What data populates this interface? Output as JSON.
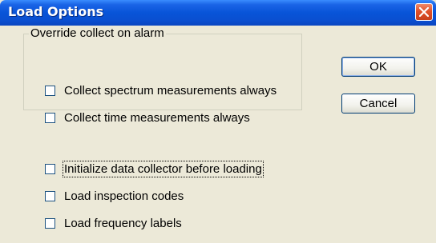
{
  "window": {
    "title": "Load Options",
    "close_icon": "close-icon"
  },
  "group": {
    "legend": "Override collect on alarm",
    "options": [
      {
        "label": "Collect spectrum measurements always",
        "checked": false
      },
      {
        "label": "Collect time measurements always",
        "checked": false
      }
    ]
  },
  "options": [
    {
      "label": "Initialize data collector before loading",
      "checked": false
    },
    {
      "label": "Load inspection codes",
      "checked": false
    },
    {
      "label": "Load frequency labels",
      "checked": false
    }
  ],
  "buttons": {
    "ok": "OK",
    "cancel": "Cancel"
  },
  "colors": {
    "title_bar": "#0854d8",
    "window_bg": "#ece9d8",
    "close_button": "#e0512a"
  }
}
